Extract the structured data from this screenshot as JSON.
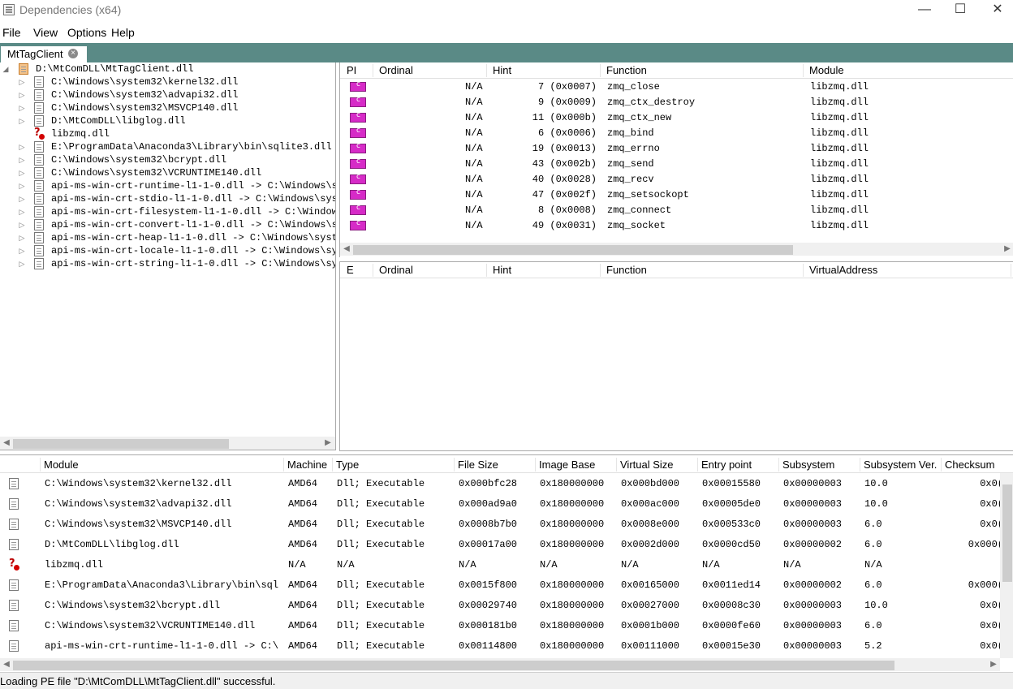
{
  "window": {
    "title": "Dependencies (x64)",
    "minimize": "—",
    "maximize": "☐",
    "close": "✕"
  },
  "menu": [
    "File",
    "View",
    "Options",
    "Help"
  ],
  "tab": {
    "label": "MtTagClient",
    "close": "×"
  },
  "tree": [
    {
      "label": "D:\\MtComDLL\\MtTagClient.dll",
      "expanded": true
    },
    {
      "label": "C:\\Windows\\system32\\kernel32.dll"
    },
    {
      "label": "C:\\Windows\\system32\\advapi32.dll"
    },
    {
      "label": "C:\\Windows\\system32\\MSVCP140.dll"
    },
    {
      "label": "D:\\MtComDLL\\libglog.dll"
    },
    {
      "label": "libzmq.dll",
      "missing": true
    },
    {
      "label": "E:\\ProgramData\\Anaconda3\\Library\\bin\\sqlite3.dll"
    },
    {
      "label": "C:\\Windows\\system32\\bcrypt.dll"
    },
    {
      "label": "C:\\Windows\\system32\\VCRUNTIME140.dll"
    },
    {
      "label": "api-ms-win-crt-runtime-l1-1-0.dll -> C:\\Windows\\s"
    },
    {
      "label": "api-ms-win-crt-stdio-l1-1-0.dll -> C:\\Windows\\sys"
    },
    {
      "label": "api-ms-win-crt-filesystem-l1-1-0.dll -> C:\\Window"
    },
    {
      "label": "api-ms-win-crt-convert-l1-1-0.dll -> C:\\Windows\\s"
    },
    {
      "label": "api-ms-win-crt-heap-l1-1-0.dll -> C:\\Windows\\syst"
    },
    {
      "label": "api-ms-win-crt-locale-l1-1-0.dll -> C:\\Windows\\sy"
    },
    {
      "label": "api-ms-win-crt-string-l1-1-0.dll -> C:\\Windows\\sy"
    }
  ],
  "imports": {
    "headers": [
      "PI",
      "Ordinal",
      "Hint",
      "Function",
      "Module"
    ],
    "rows": [
      {
        "ordinal": "N/A",
        "hint": "7 (0x0007)",
        "function": "zmq_close",
        "module": "libzmq.dll"
      },
      {
        "ordinal": "N/A",
        "hint": "9 (0x0009)",
        "function": "zmq_ctx_destroy",
        "module": "libzmq.dll"
      },
      {
        "ordinal": "N/A",
        "hint": "11 (0x000b)",
        "function": "zmq_ctx_new",
        "module": "libzmq.dll"
      },
      {
        "ordinal": "N/A",
        "hint": "6 (0x0006)",
        "function": "zmq_bind",
        "module": "libzmq.dll"
      },
      {
        "ordinal": "N/A",
        "hint": "19 (0x0013)",
        "function": "zmq_errno",
        "module": "libzmq.dll"
      },
      {
        "ordinal": "N/A",
        "hint": "43 (0x002b)",
        "function": "zmq_send",
        "module": "libzmq.dll"
      },
      {
        "ordinal": "N/A",
        "hint": "40 (0x0028)",
        "function": "zmq_recv",
        "module": "libzmq.dll"
      },
      {
        "ordinal": "N/A",
        "hint": "47 (0x002f)",
        "function": "zmq_setsockopt",
        "module": "libzmq.dll"
      },
      {
        "ordinal": "N/A",
        "hint": "8 (0x0008)",
        "function": "zmq_connect",
        "module": "libzmq.dll"
      },
      {
        "ordinal": "N/A",
        "hint": "49 (0x0031)",
        "function": "zmq_socket",
        "module": "libzmq.dll"
      }
    ]
  },
  "exports": {
    "headers": [
      "E",
      "Ordinal",
      "Hint",
      "Function",
      "VirtualAddress"
    ]
  },
  "modules": {
    "headers": [
      "Module",
      "Machine",
      "Type",
      "File Size",
      "Image Base",
      "Virtual Size",
      "Entry point",
      "Subsystem",
      "Subsystem Ver.",
      "Checksum"
    ],
    "rows": [
      {
        "module": "C:\\Windows\\system32\\kernel32.dll",
        "machine": "AMD64",
        "type": "Dll; Executable",
        "file_size": "0x000bfc28",
        "image_base": "0x180000000",
        "virtual_size": "0x000bd000",
        "entry": "0x00015580",
        "subsystem": "0x00000003",
        "subver": "10.0",
        "checksum": "0x0("
      },
      {
        "module": "C:\\Windows\\system32\\advapi32.dll",
        "machine": "AMD64",
        "type": "Dll; Executable",
        "file_size": "0x000ad9a0",
        "image_base": "0x180000000",
        "virtual_size": "0x000ac000",
        "entry": "0x00005de0",
        "subsystem": "0x00000003",
        "subver": "10.0",
        "checksum": "0x0("
      },
      {
        "module": "C:\\Windows\\system32\\MSVCP140.dll",
        "machine": "AMD64",
        "type": "Dll; Executable",
        "file_size": "0x0008b7b0",
        "image_base": "0x180000000",
        "virtual_size": "0x0008e000",
        "entry": "0x000533c0",
        "subsystem": "0x00000003",
        "subver": "6.0",
        "checksum": "0x0("
      },
      {
        "module": "D:\\MtComDLL\\libglog.dll",
        "machine": "AMD64",
        "type": "Dll; Executable",
        "file_size": "0x00017a00",
        "image_base": "0x180000000",
        "virtual_size": "0x0002d000",
        "entry": "0x0000cd50",
        "subsystem": "0x00000002",
        "subver": "6.0",
        "checksum": "0x000("
      },
      {
        "module": "libzmq.dll",
        "missing": true,
        "machine": "N/A",
        "type": "N/A",
        "file_size": "N/A",
        "image_base": "N/A",
        "virtual_size": "N/A",
        "entry": "N/A",
        "subsystem": "N/A",
        "subver": "N/A",
        "checksum": ""
      },
      {
        "module": "E:\\ProgramData\\Anaconda3\\Library\\bin\\sql",
        "machine": "AMD64",
        "type": "Dll; Executable",
        "file_size": "0x0015f800",
        "image_base": "0x180000000",
        "virtual_size": "0x00165000",
        "entry": "0x0011ed14",
        "subsystem": "0x00000002",
        "subver": "6.0",
        "checksum": "0x000("
      },
      {
        "module": "C:\\Windows\\system32\\bcrypt.dll",
        "machine": "AMD64",
        "type": "Dll; Executable",
        "file_size": "0x00029740",
        "image_base": "0x180000000",
        "virtual_size": "0x00027000",
        "entry": "0x00008c30",
        "subsystem": "0x00000003",
        "subver": "10.0",
        "checksum": "0x0("
      },
      {
        "module": "C:\\Windows\\system32\\VCRUNTIME140.dll",
        "machine": "AMD64",
        "type": "Dll; Executable",
        "file_size": "0x000181b0",
        "image_base": "0x180000000",
        "virtual_size": "0x0001b000",
        "entry": "0x0000fe60",
        "subsystem": "0x00000003",
        "subver": "6.0",
        "checksum": "0x0("
      },
      {
        "module": "api-ms-win-crt-runtime-l1-1-0.dll -> C:\\",
        "machine": "AMD64",
        "type": "Dll; Executable",
        "file_size": "0x00114800",
        "image_base": "0x180000000",
        "virtual_size": "0x00111000",
        "entry": "0x00015e30",
        "subsystem": "0x00000003",
        "subver": "5.2",
        "checksum": "0x0("
      }
    ]
  },
  "status": "Loading PE file \"D:\\MtComDLL\\MtTagClient.dll\" successful."
}
